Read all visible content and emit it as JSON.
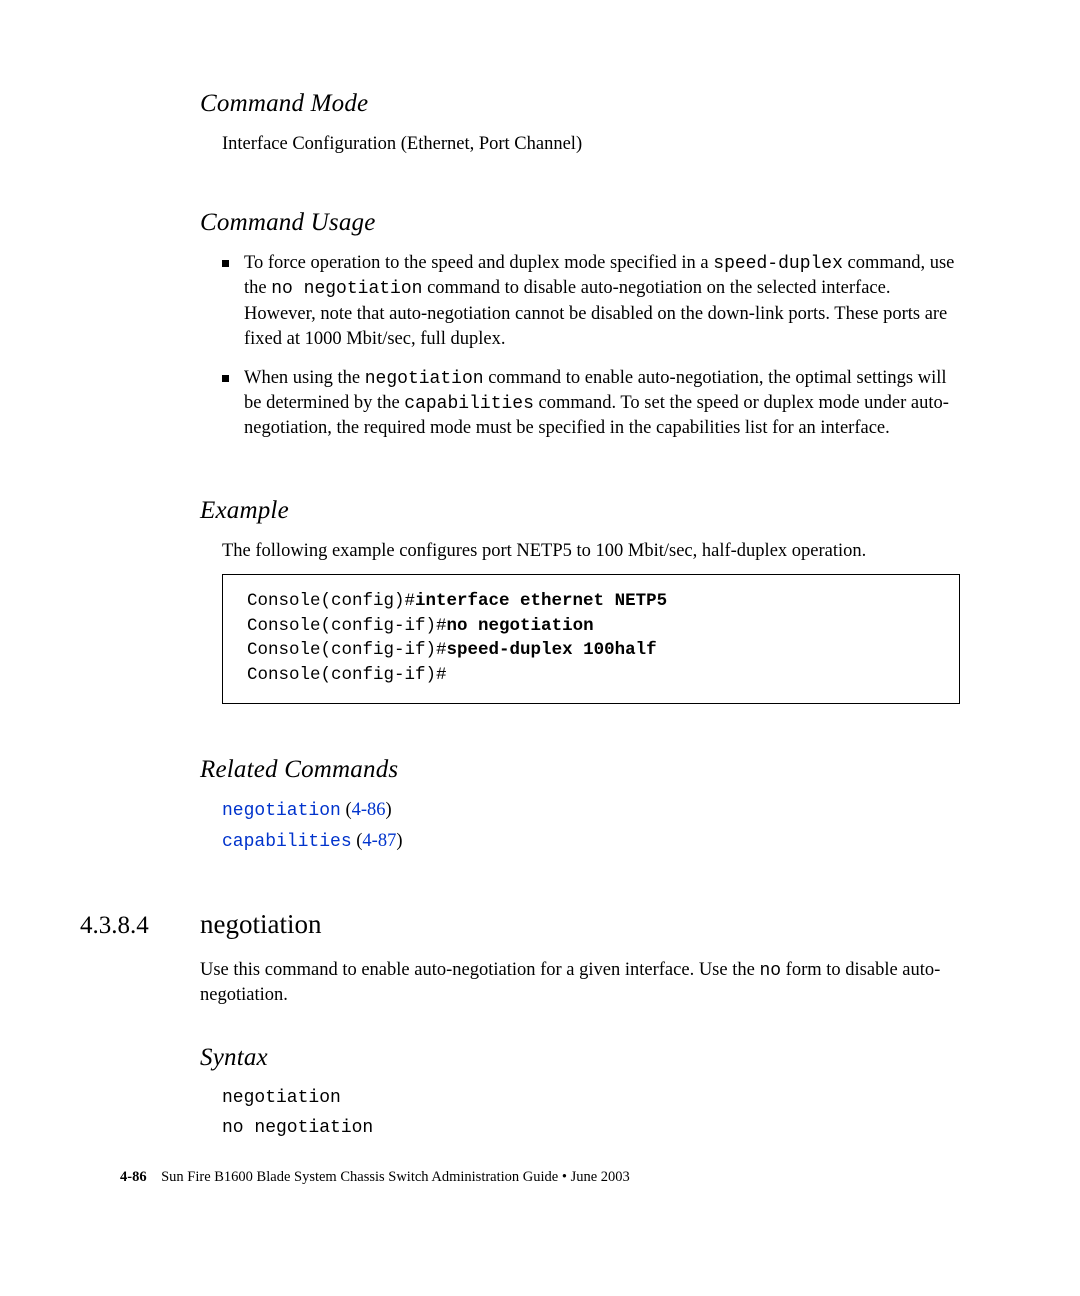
{
  "headings": {
    "mode": "Command Mode",
    "usage": "Command Usage",
    "example": "Example",
    "related": "Related Commands",
    "syntax": "Syntax"
  },
  "mode_text": "Interface Configuration (Ethernet, Port Channel)",
  "usage": {
    "b1_pre": "To force operation to the speed and duplex mode specified in a ",
    "b1_code1": "speed-duplex",
    "b1_mid1": " command, use the ",
    "b1_code2": "no negotiation",
    "b1_post": " command to disable auto-negotiation on the selected interface. However, note that auto-negotiation cannot be disabled on the down-link ports. These ports are fixed at 1000 Mbit/sec, full duplex.",
    "b2_pre": "When using the ",
    "b2_code1": "negotiation",
    "b2_mid1": " command to enable auto-negotiation, the optimal settings will be determined by the ",
    "b2_code2": "capabilities",
    "b2_post": " command. To set the speed or duplex mode under auto-negotiation, the required mode must be specified in the capabilities list for an interface."
  },
  "example_text": "The following example configures port NETP5 to 100 Mbit/sec, half-duplex operation.",
  "code": {
    "l1p": "Console(config)#",
    "l1b": "interface ethernet NETP5",
    "l2p": "Console(config-if)#",
    "l2b": "no negotiation",
    "l3p": "Console(config-if)#",
    "l3b": "speed-duplex 100half",
    "l4p": "Console(config-if)#"
  },
  "related": {
    "r1_cmd": "negotiation",
    "r1_ref": "4-86",
    "r2_cmd": "capabilities",
    "r2_ref": "4-87"
  },
  "section": {
    "num": "4.3.8.4",
    "title": "negotiation"
  },
  "section_body_pre": "Use this command to enable auto-negotiation for a given interface. Use the ",
  "section_body_code": "no",
  "section_body_post": " form to disable auto-negotiation.",
  "syntax": {
    "l1": "negotiation",
    "l2": "no negotiation"
  },
  "footer": {
    "page": "4-86",
    "title": "Sun Fire B1600 Blade System Chassis Switch Administration Guide • June 2003"
  }
}
